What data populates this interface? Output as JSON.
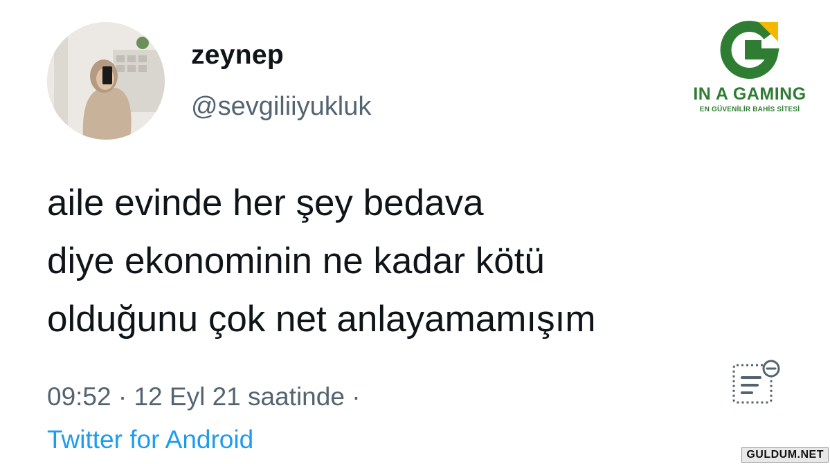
{
  "profile": {
    "display_name": "zeynep",
    "handle": "@sevgiliiyukluk"
  },
  "tweet": {
    "lines": [
      "aile evinde her şey bedava",
      "diye ekonominin ne kadar kötü",
      "olduğunu çok net anlayamamışım"
    ],
    "timestamp": "09:52 · 12 Eyl 21 saatinde ·",
    "source": "Twitter for Android"
  },
  "icons": {
    "analytics": "analytics-icon"
  },
  "brand": {
    "name": "IN A GAMING",
    "tagline": "EN GÜVENİLİR BAHİS SİTESİ",
    "colors": {
      "green": "#2e7d32",
      "yellow": "#f5b800"
    }
  },
  "watermark": "GULDUM.NET",
  "colors": {
    "text": "#0f1419",
    "secondary": "#536471",
    "link": "#1d9bf0"
  }
}
